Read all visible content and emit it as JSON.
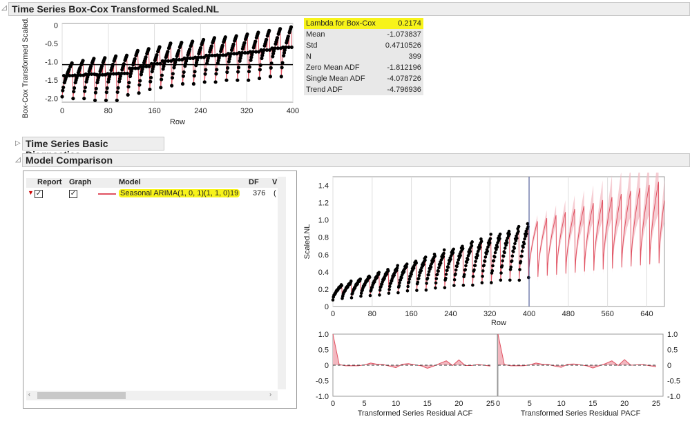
{
  "sections": {
    "boxcox_title": "Time Series Box-Cox Transformed Scaled.NL",
    "diagnostics_title": "Time Series Basic Diagnostics",
    "model_comparison_title": "Model Comparison"
  },
  "stats": [
    {
      "label": "Lambda for Box-Cox",
      "value": "0.2174"
    },
    {
      "label": "Mean",
      "value": "-1.073837"
    },
    {
      "label": "Std",
      "value": "0.4710526"
    },
    {
      "label": "N",
      "value": "399"
    },
    {
      "label": "Zero Mean ADF",
      "value": "-1.812196"
    },
    {
      "label": "Single Mean ADF",
      "value": "-4.078726"
    },
    {
      "label": "Trend ADF",
      "value": "-4.796936"
    }
  ],
  "model_table": {
    "headers": {
      "report": "Report",
      "graph": "Graph",
      "model": "Model",
      "df": "DF",
      "extra": "V"
    },
    "rows": [
      {
        "report": true,
        "graph": true,
        "model": "Seasonal ARIMA(1, 0, 1)(1, 1, 0)19",
        "df": "376",
        "extra": "("
      }
    ]
  },
  "colors": {
    "series": "#e05060",
    "band": "#f2b8c0",
    "highlight": "#f7f31a"
  },
  "chart_data": [
    {
      "type": "scatter",
      "title": "",
      "xlabel": "Row",
      "ylabel": "Box-Cox Transformed Scaled.NL",
      "xlim": [
        0,
        400
      ],
      "ylim": [
        -2.1,
        0.05
      ],
      "xticks": [
        "0",
        "80",
        "160",
        "240",
        "320",
        "400"
      ],
      "yticks": [
        "0",
        "-0.5",
        "-1.0",
        "-1.5",
        "-2.0"
      ],
      "mean_line": -1.073837,
      "season_length": 19,
      "cycle_low": [
        -1.95,
        -2.0,
        -2.0,
        -2.05,
        -2.05,
        -2.05,
        -1.9,
        -1.85,
        -1.75,
        -1.7,
        -1.65,
        -1.6,
        -1.6,
        -1.55,
        -1.55,
        -1.5,
        -1.5,
        -1.5,
        -1.45,
        -1.4,
        -1.4
      ],
      "cycle_high": [
        -1.0,
        -0.93,
        -0.87,
        -0.85,
        -0.8,
        -0.78,
        -0.65,
        -0.6,
        -0.55,
        -0.45,
        -0.43,
        -0.4,
        -0.35,
        -0.3,
        -0.28,
        -0.25,
        -0.2,
        -0.15,
        -0.1,
        -0.05,
        0.0
      ]
    },
    {
      "type": "line",
      "xlabel": "Row",
      "ylabel": "Scaled.NL",
      "xlim": [
        0,
        676
      ],
      "ylim": [
        0,
        1.5
      ],
      "xticks": [
        "0",
        "80",
        "160",
        "240",
        "320",
        "400",
        "480",
        "560",
        "640"
      ],
      "yticks": [
        "0",
        "0.2",
        "0.4",
        "0.6",
        "0.8",
        "1.0",
        "1.2",
        "1.4"
      ],
      "forecast_start": 400
    },
    {
      "type": "area",
      "title": "Transformed Series Residual ACF",
      "xlim": [
        0,
        25
      ],
      "ylim": [
        -1,
        1
      ],
      "xticks": [
        "0",
        "5",
        "10",
        "15",
        "20",
        "25"
      ],
      "yticks": [
        "1.0",
        "0.5",
        "0",
        "-0.5",
        "-1.0"
      ],
      "values": [
        1,
        0.02,
        -0.02,
        -0.02,
        -0.02,
        0.01,
        0.07,
        0.03,
        0.02,
        -0.03,
        -0.08,
        0.03,
        0.05,
        0.01,
        -0.02,
        -0.1,
        -0.03,
        0.06,
        0.14,
        -0.01,
        0.17,
        -0.01,
        -0.01,
        0.02,
        0,
        -0.03
      ]
    },
    {
      "type": "area",
      "title": "Transformed Series Residual PACF",
      "xlim": [
        0,
        25
      ],
      "ylim": [
        -1,
        1
      ],
      "xticks": [
        "0",
        "5",
        "10",
        "15",
        "20",
        "25"
      ],
      "yticks": [
        "1.0",
        "0.5",
        "0",
        "-0.5",
        "-1.0"
      ],
      "values": [
        1,
        0.02,
        -0.02,
        -0.02,
        -0.02,
        0.01,
        0.07,
        0.03,
        0.02,
        -0.03,
        -0.07,
        0.03,
        0.04,
        0.01,
        -0.02,
        -0.09,
        -0.02,
        0.05,
        0.14,
        -0.01,
        0.18,
        0,
        0.01,
        0.02,
        -0.02,
        -0.05
      ]
    }
  ]
}
